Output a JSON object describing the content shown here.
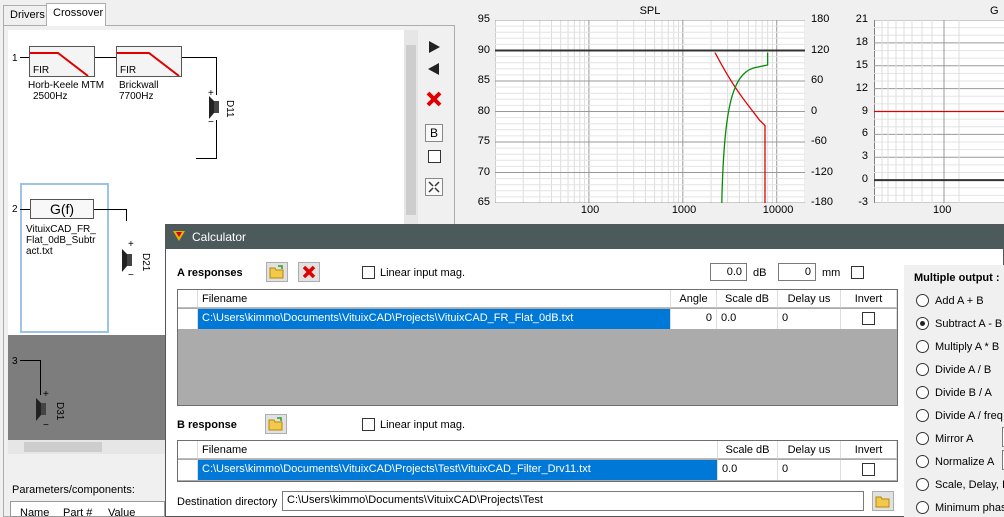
{
  "tabs": [
    "Drivers",
    "Crossover"
  ],
  "crossover": {
    "row_numbers": [
      "1",
      "2",
      "3"
    ],
    "block1": {
      "type": "FIR",
      "name": "Horb-Keele MTM",
      "freq": "2500Hz"
    },
    "block2": {
      "type": "FIR",
      "name": "Brickwall",
      "freq": "7700Hz"
    },
    "gf_block": {
      "label": "G(f)",
      "file": [
        "VituixCAD_FR_",
        "Flat_0dB_Subtr",
        "act.txt"
      ]
    },
    "drivers": [
      "D11",
      "D21",
      "D31"
    ],
    "sign_plus": "+",
    "sign_minus": "−",
    "side_b": "B",
    "params_label": "Parameters/components:",
    "params_cols": [
      "Name",
      "Part #",
      "Value"
    ]
  },
  "spl_chart": {
    "title": "SPL",
    "left_ticks": [
      "95",
      "90",
      "85",
      "80",
      "75",
      "70",
      "65"
    ],
    "right_ticks": [
      "180",
      "120",
      "60",
      "0",
      "-60",
      "-120",
      "-180"
    ],
    "x_ticks": [
      "100",
      "1000",
      "10000"
    ]
  },
  "g_chart": {
    "title": "G",
    "left_ticks": [
      "21",
      "18",
      "15",
      "12",
      "9",
      "6",
      "3",
      "0",
      "-3"
    ],
    "x_ticks": [
      "100"
    ]
  },
  "calculator": {
    "title": "Calculator",
    "a_label": "A responses",
    "b_label": "B response",
    "linear_label": "Linear input mag.",
    "db_value": "0.0",
    "db_unit": "dB",
    "mm_value": "0",
    "mm_unit": "mm",
    "a_cols": [
      "Filename",
      "Angle",
      "Scale dB",
      "Delay us",
      "Invert"
    ],
    "a_row": {
      "filename": "C:\\Users\\kimmo\\Documents\\VituixCAD\\Projects\\VituixCAD_FR_Flat_0dB.txt",
      "angle": "0",
      "scale": "0.0",
      "delay": "0"
    },
    "b_cols": [
      "Filename",
      "Scale dB",
      "Delay us",
      "Invert"
    ],
    "b_row": {
      "filename": "C:\\Users\\kimmo\\Documents\\VituixCAD\\Projects\\Test\\VituixCAD_Filter_Drv11.txt",
      "scale": "0.0",
      "delay": "0"
    },
    "dest_label": "Destination directory",
    "dest_value": "C:\\Users\\kimmo\\Documents\\VituixCAD\\Projects\\Test",
    "multi_label": "Multiple output :",
    "ops": [
      "Add A + B",
      "Subtract A - B",
      "Multiply A * B",
      "Divide A / B",
      "Divide B / A",
      "Divide A / freq",
      "Mirror A",
      "Normalize A",
      "Scale, Delay, In",
      "Minimum phase"
    ],
    "selected_op": 1
  }
}
